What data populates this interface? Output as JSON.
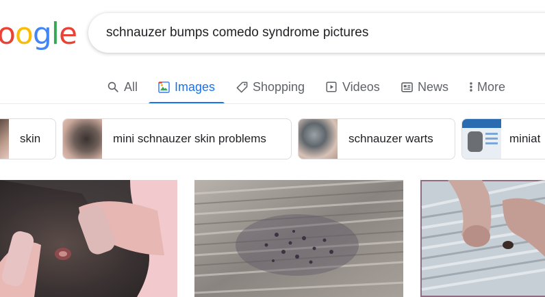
{
  "logo": {
    "letters": [
      "o",
      "o",
      "g",
      "l",
      "e"
    ],
    "colors": [
      "#ea4335",
      "#fbbc05",
      "#4285f4",
      "#34a853",
      "#ea4335"
    ]
  },
  "search": {
    "query": "schnauzer bumps comedo syndrome pictures"
  },
  "tabs": [
    {
      "label": "All",
      "icon": "search-icon",
      "active": false
    },
    {
      "label": "Images",
      "icon": "image-icon",
      "active": true
    },
    {
      "label": "Shopping",
      "icon": "tag-icon",
      "active": false
    },
    {
      "label": "Videos",
      "icon": "play-icon",
      "active": false
    },
    {
      "label": "News",
      "icon": "newspaper-icon",
      "active": false
    },
    {
      "label": "More",
      "icon": "more-vert-icon",
      "active": false
    }
  ],
  "chips": [
    {
      "label": "skin"
    },
    {
      "label": "mini schnauzer skin problems"
    },
    {
      "label": "schnauzer warts"
    },
    {
      "label": "miniat"
    }
  ],
  "colors": {
    "accent": "#1a73e8",
    "text": "#202124",
    "muted": "#5f6368"
  }
}
